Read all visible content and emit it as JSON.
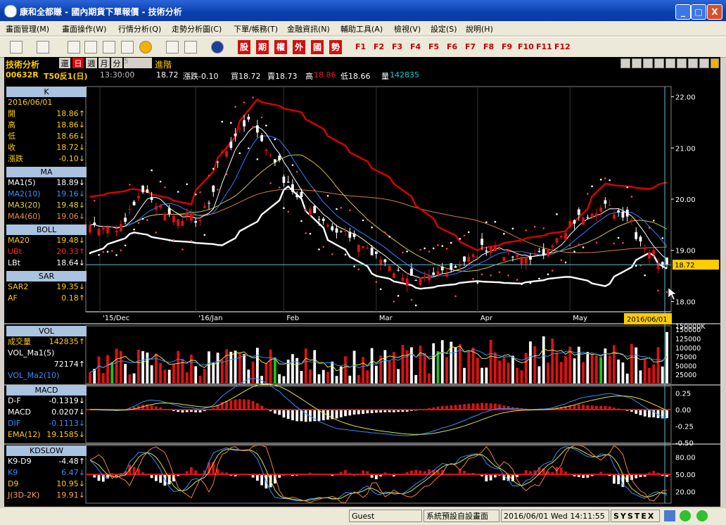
{
  "window": {
    "title": "康和全都賺 - 國內期貨下單報價 - 技術分析",
    "minimize": "_",
    "maximize": "□",
    "close": "X"
  },
  "menu": [
    "畫面管理(M)",
    "畫面操作(W)",
    "行情分析(Q)",
    "走勢分析圖(C)",
    "下單/帳務(T)",
    "金融資訊(N)",
    "輔助工具(A)",
    "檢視(V)",
    "設定(S)",
    "說明(H)"
  ],
  "toolbar": {
    "red_buttons": [
      "股",
      "期",
      "權",
      "外",
      "國",
      "勢"
    ],
    "fkeys": [
      "F1",
      "F2",
      "F3",
      "F4",
      "F5",
      "F6",
      "F7",
      "F8",
      "F9",
      "F10",
      "F11",
      "F12"
    ]
  },
  "info": {
    "panel_title": "技術分析",
    "btn_restore": "還",
    "btn_day": "日",
    "btn_week": "週",
    "btn_month": "月",
    "btn_minute": "分",
    "min_value": "5",
    "advanced": "進階",
    "symbol": "00632R",
    "name": "T50反1(日)",
    "time": "13:30:00",
    "price": "18.72",
    "change": "漲跌-0.10",
    "bid": "買18.72",
    "ask": "賣18.73",
    "high_label": "高",
    "high": "18.86",
    "low": "低18.66",
    "vol_label": "量",
    "vol": "142835"
  },
  "left": {
    "k": {
      "hd": "K",
      "date": "2016/06/01",
      "rows": [
        [
          "開",
          "18.86",
          "↑"
        ],
        [
          "高",
          "18.86",
          "↓"
        ],
        [
          "低",
          "18.66",
          "↓"
        ],
        [
          "收",
          "18.72",
          "↓"
        ],
        [
          "漲跌",
          "-0.10",
          "↓"
        ]
      ]
    },
    "ma": {
      "hd": "MA",
      "rows": [
        [
          "MA1(5)",
          "18.89",
          "↓"
        ],
        [
          "MA2(10)",
          "19.16",
          "↓"
        ],
        [
          "MA3(20)",
          "19.48",
          "↓"
        ],
        [
          "MA4(60)",
          "19.06",
          "↓"
        ]
      ]
    },
    "boll": {
      "hd": "BOLL",
      "rows": [
        [
          "MA20",
          "19.48",
          "↓"
        ],
        [
          "UBt",
          "20.33",
          "↑"
        ],
        [
          "LBt",
          "18.64",
          "↓"
        ]
      ]
    },
    "sar": {
      "hd": "SAR",
      "rows": [
        [
          "SAR2",
          "19.35",
          "↓"
        ],
        [
          "AF",
          "0.18",
          "↑"
        ]
      ]
    },
    "vol": {
      "hd": "VOL",
      "rows": [
        [
          "成交量",
          "142835",
          "↑"
        ],
        [
          "VOL_Ma1(5)",
          "",
          ""
        ],
        [
          "",
          "72174",
          "↑"
        ],
        [
          "VOL_Ma2(10)",
          "",
          ""
        ]
      ]
    },
    "macd": {
      "hd": "MACD",
      "rows": [
        [
          "D-F",
          "-0.1319",
          "↓"
        ],
        [
          "MACD",
          "0.0207",
          "↓"
        ],
        [
          "DIF",
          "-0.1113",
          "↓"
        ],
        [
          "EMA(12)",
          "19.1585",
          "↓"
        ]
      ]
    },
    "kd": {
      "hd": "KDSLOW",
      "rows": [
        [
          "K9-D9",
          "-4.48",
          "↑"
        ],
        [
          "K9",
          "6.47",
          "↓"
        ],
        [
          "D9",
          "10.95",
          "↓"
        ],
        [
          "J(3D-2K)",
          "19.91",
          "↓"
        ]
      ]
    }
  },
  "axes": {
    "price_ticks": [
      "22.00",
      "21.00",
      "20.00",
      "19.00",
      "18.00"
    ],
    "price_last": "18.72",
    "months": [
      "'15/Dec",
      "'16/Jan",
      "Feb",
      "Mar",
      "Apr",
      "May"
    ],
    "cursor_date": "2016/06/01",
    "vol_ticks": [
      "150000K",
      "150000",
      "125000",
      "100000",
      "75000",
      "50000",
      "25000"
    ],
    "macd_ticks": [
      "0.25",
      "0.00",
      "-0.25",
      "-0.50"
    ],
    "kd_ticks": [
      "80.00",
      "50.00",
      "20.00"
    ]
  },
  "colors": {
    "up": "#e01010",
    "down": "#ffffff",
    "upper_band": "#dd0000",
    "lower_band": "#ffffff",
    "last_price": "#ffcc00",
    "panel_header": "#a9c3e0"
  },
  "status": {
    "user": "Guest",
    "layout": "系統預設自設畫面",
    "datetime": "2016/06/01 Wed 14:11:55",
    "brand": "SYSTEX"
  },
  "chart_data": {
    "type": "candlestick",
    "title": "",
    "ylabel": "",
    "ylim": [
      17.8,
      22.2
    ],
    "close_anchors": [
      [
        "2015-12-01",
        19.5
      ],
      [
        "2015-12-10",
        19.45
      ],
      [
        "2015-12-18",
        20.2
      ],
      [
        "2015-12-25",
        19.7
      ],
      [
        "2016-01-05",
        19.6
      ],
      [
        "2016-01-12",
        20.9
      ],
      [
        "2016-01-20",
        21.55
      ],
      [
        "2016-01-27",
        20.9
      ],
      [
        "2016-02-03",
        20.15
      ],
      [
        "2016-02-10",
        19.7
      ],
      [
        "2016-02-19",
        19.35
      ],
      [
        "2016-02-26",
        19.05
      ],
      [
        "2016-03-07",
        18.6
      ],
      [
        "2016-03-14",
        18.35
      ],
      [
        "2016-03-22",
        18.6
      ],
      [
        "2016-03-29",
        18.8
      ],
      [
        "2016-04-06",
        19.1
      ],
      [
        "2016-04-14",
        18.85
      ],
      [
        "2016-04-21",
        18.9
      ],
      [
        "2016-04-28",
        19.25
      ],
      [
        "2016-05-05",
        19.7
      ],
      [
        "2016-05-12",
        19.85
      ],
      [
        "2016-05-19",
        19.7
      ],
      [
        "2016-05-26",
        19.0
      ],
      [
        "2016-06-01",
        18.72
      ]
    ],
    "upper_band_anchors": [
      [
        "2015-12-01",
        20.05
      ],
      [
        "2015-12-15",
        20.2
      ],
      [
        "2016-01-01",
        19.9
      ],
      [
        "2016-01-12",
        20.9
      ],
      [
        "2016-01-22",
        21.95
      ],
      [
        "2016-02-05",
        21.7
      ],
      [
        "2016-02-20",
        21.0
      ],
      [
        "2016-03-07",
        20.3
      ],
      [
        "2016-03-20",
        19.5
      ],
      [
        "2016-04-01",
        19.0
      ],
      [
        "2016-04-15",
        19.2
      ],
      [
        "2016-05-01",
        19.4
      ],
      [
        "2016-05-12",
        20.3
      ],
      [
        "2016-05-26",
        20.2
      ],
      [
        "2016-06-01",
        20.33
      ]
    ],
    "lower_band_anchors": [
      [
        "2015-12-01",
        18.95
      ],
      [
        "2015-12-15",
        19.35
      ],
      [
        "2015-12-25",
        19.2
      ],
      [
        "2016-01-12",
        19.1
      ],
      [
        "2016-01-25",
        19.7
      ],
      [
        "2016-02-02",
        20.25
      ],
      [
        "2016-02-15",
        19.2
      ],
      [
        "2016-03-01",
        18.5
      ],
      [
        "2016-03-15",
        18.25
      ],
      [
        "2016-04-01",
        18.4
      ],
      [
        "2016-04-15",
        18.35
      ],
      [
        "2016-05-01",
        18.5
      ],
      [
        "2016-05-12",
        18.3
      ],
      [
        "2016-05-26",
        18.95
      ],
      [
        "2016-06-01",
        18.64
      ]
    ]
  }
}
